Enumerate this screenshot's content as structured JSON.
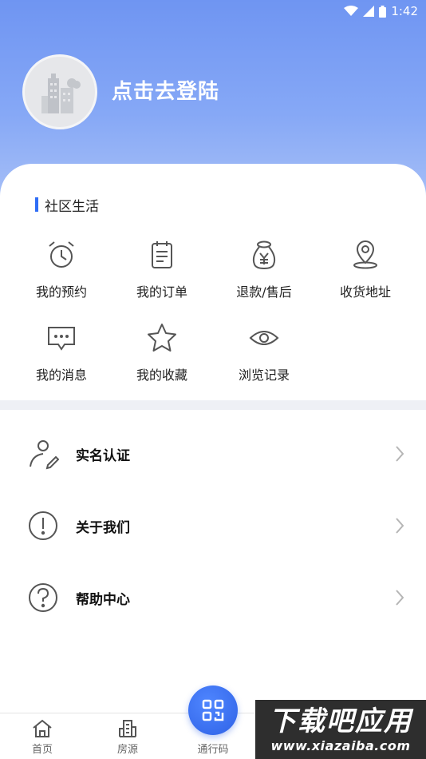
{
  "status_bar": {
    "time": "1:42"
  },
  "profile": {
    "login_text": "点击去登陆"
  },
  "community": {
    "title": "社区生活",
    "items": [
      {
        "label": "我的预约",
        "icon": "alarm-clock-icon"
      },
      {
        "label": "我的订单",
        "icon": "clipboard-icon"
      },
      {
        "label": "退款/售后",
        "icon": "money-bag-icon"
      },
      {
        "label": "收货地址",
        "icon": "location-pin-icon"
      },
      {
        "label": "我的消息",
        "icon": "message-icon"
      },
      {
        "label": "我的收藏",
        "icon": "star-icon"
      },
      {
        "label": "浏览记录",
        "icon": "eye-icon"
      }
    ]
  },
  "menu": [
    {
      "label": "实名认证",
      "icon": "user-edit-icon"
    },
    {
      "label": "关于我们",
      "icon": "info-exclamation-icon"
    },
    {
      "label": "帮助中心",
      "icon": "question-icon"
    }
  ],
  "tabbar": {
    "home": "首页",
    "housing": "房源",
    "pass_code": "通行码"
  },
  "watermark": {
    "title": "下载吧应用",
    "url": "www.xiazaiba.com"
  },
  "colors": {
    "accent": "#2f6df6",
    "hero_top": "#6f95f2",
    "icon_gray": "#555555"
  }
}
